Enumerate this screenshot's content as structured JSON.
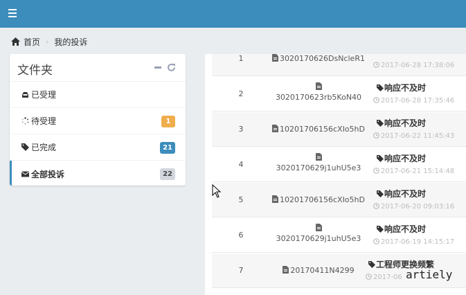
{
  "colors": {
    "topbar": "#3c8dbc",
    "active": "#3c8dbc",
    "badge_orange": "#f39c12",
    "badge_blue": "#3c8dbc",
    "badge_gray": "#d2d6de"
  },
  "breadcrumb": {
    "home": "首页",
    "current": "我的投诉"
  },
  "folders": {
    "title": "文件夹",
    "items": [
      {
        "label": "已受理",
        "icon": "inbox-icon",
        "badge": ""
      },
      {
        "label": "待受理",
        "icon": "spinner-icon",
        "badge": "1"
      },
      {
        "label": "已完成",
        "icon": "tag-icon",
        "badge": "21"
      },
      {
        "label": "全部投诉",
        "icon": "envelope-icon",
        "badge": "22"
      }
    ]
  },
  "complaints": [
    {
      "num": "1",
      "code": "3020170626DsNcleR1",
      "issue": "",
      "time": "2017-06-28 17:38:06"
    },
    {
      "num": "2",
      "code": "3020170623rb5KoN40",
      "issue": "响应不及时",
      "time": "2017-06-28 17:35:46"
    },
    {
      "num": "3",
      "code": "10201706156cXIo5hD",
      "issue": "响应不及时",
      "time": "2017-06-22 11:45:43"
    },
    {
      "num": "4",
      "code": "3020170629j1uhU5e3",
      "issue": "响应不及时",
      "time": "2017-06-21 15:14:48"
    },
    {
      "num": "5",
      "code": "10201706156cXIo5hD",
      "issue": "响应不及时",
      "time": "2017-06-20 09:03:16"
    },
    {
      "num": "6",
      "code": "3020170629j1uhU5e3",
      "issue": "响应不及时",
      "time": "2017-06-19 14:15:17"
    },
    {
      "num": "7",
      "code": "20170411N4299",
      "issue": "工程师更换频繁",
      "time": "2017-06"
    }
  ],
  "watermark": "artiely"
}
